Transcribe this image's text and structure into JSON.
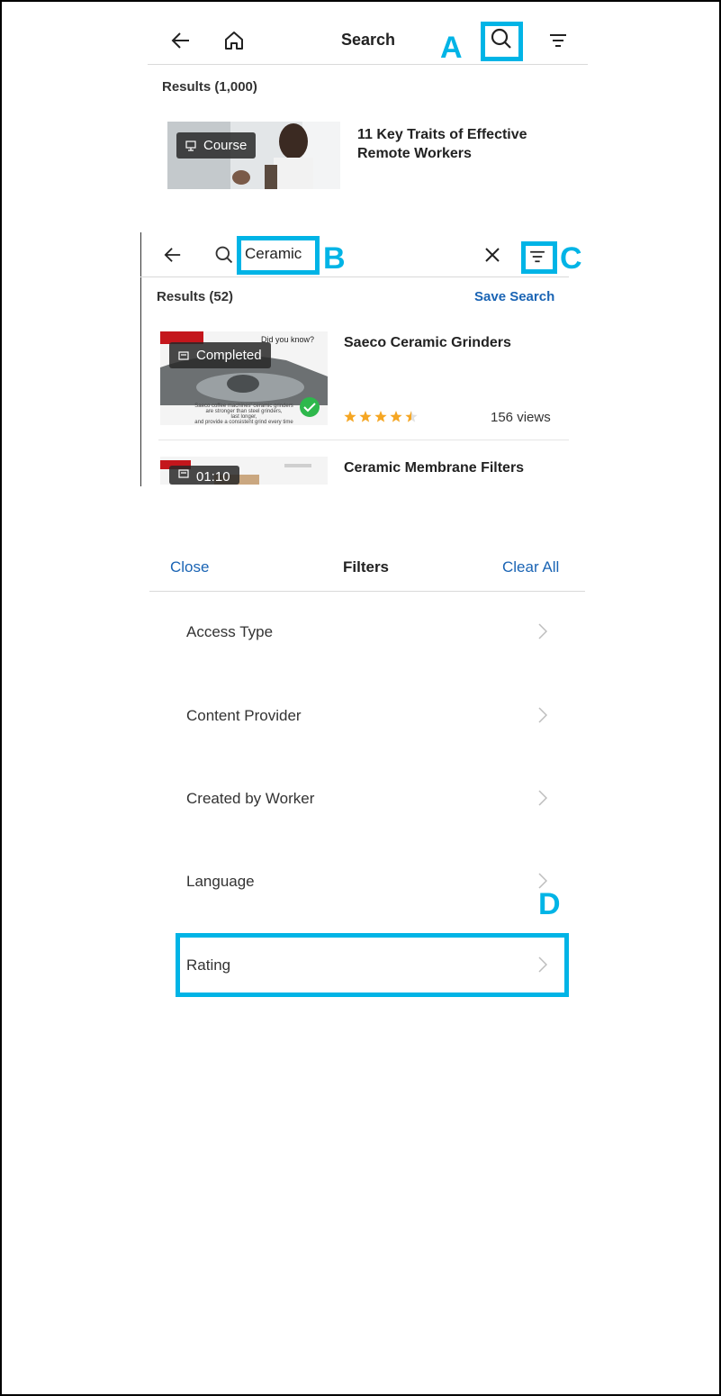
{
  "panel1": {
    "header": {
      "title": "Search"
    },
    "results_label": "Results (1,000)",
    "item": {
      "badge": "Course",
      "title_line1": "11 Key Traits of Effective",
      "title_line2": "Remote Workers"
    }
  },
  "panel2": {
    "search_value": "Ceramic",
    "results_label": "Results (52)",
    "save_search": "Save Search",
    "items": [
      {
        "badge": "Completed",
        "title": "Saeco Ceramic Grinders",
        "rating": 4.5,
        "views": "156 views",
        "thumb_text_top": "Did you know?",
        "thumb_text_bottom1": "Saeco coffee machines' ceramic grinders",
        "thumb_text_bottom2": "are stronger than steel grinders,",
        "thumb_text_bottom3": "last longer,",
        "thumb_text_bottom4": "and provide a consistent grind every time"
      },
      {
        "badge": "01:10",
        "title": "Ceramic Membrane Filters"
      }
    ]
  },
  "filters": {
    "close": "Close",
    "title": "Filters",
    "clear_all": "Clear All",
    "rows": [
      "Access Type",
      "Content Provider",
      "Created by Worker",
      "Language",
      "Rating"
    ]
  },
  "markers": {
    "a": "A",
    "b": "B",
    "c": "C",
    "d": "D"
  },
  "colors": {
    "highlight": "#00b4e6",
    "link": "#1a64b4",
    "star": "#f5a623",
    "check": "#2eb84c"
  }
}
